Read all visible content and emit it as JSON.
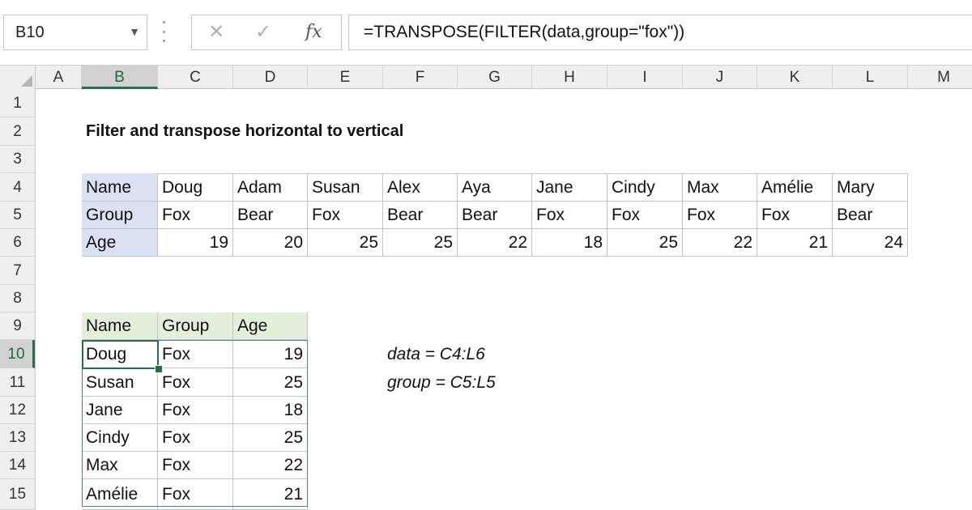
{
  "formula_bar": {
    "name_box": "B10",
    "cancel_icon": "x-icon",
    "enter_icon": "check-icon",
    "fx_label": "fx",
    "formula": "=TRANSPOSE(FILTER(data,group=\"fox\"))"
  },
  "columns": [
    "A",
    "B",
    "C",
    "D",
    "E",
    "F",
    "G",
    "H",
    "I",
    "J",
    "K",
    "L",
    "M"
  ],
  "rows": [
    "1",
    "2",
    "3",
    "4",
    "5",
    "6",
    "7",
    "8",
    "9",
    "10",
    "11",
    "12",
    "13",
    "14",
    "15"
  ],
  "active_column": "B",
  "active_row": "10",
  "title": "Filter and transpose horizontal to vertical",
  "source": {
    "name_label": "Name",
    "group_label": "Group",
    "age_label": "Age",
    "names": [
      "Doug",
      "Adam",
      "Susan",
      "Alex",
      "Aya",
      "Jane",
      "Cindy",
      "Max",
      "Amélie",
      "Mary"
    ],
    "groups": [
      "Fox",
      "Bear",
      "Fox",
      "Bear",
      "Bear",
      "Fox",
      "Fox",
      "Fox",
      "Fox",
      "Bear"
    ],
    "ages": [
      "19",
      "20",
      "25",
      "25",
      "22",
      "18",
      "25",
      "22",
      "21",
      "24"
    ]
  },
  "result": {
    "headers": [
      "Name",
      "Group",
      "Age"
    ],
    "rows": [
      [
        "Doug",
        "Fox",
        "19"
      ],
      [
        "Susan",
        "Fox",
        "25"
      ],
      [
        "Jane",
        "Fox",
        "18"
      ],
      [
        "Cindy",
        "Fox",
        "25"
      ],
      [
        "Max",
        "Fox",
        "22"
      ],
      [
        "Amélie",
        "Fox",
        "21"
      ]
    ]
  },
  "notes": [
    "data = C4:L6",
    "group = C5:L5"
  ],
  "colors": {
    "source_header_fill": "#d9e1f2",
    "result_header_fill": "#e2efda",
    "spill_border": "#4a7ebb",
    "active_cell": "#217346"
  }
}
